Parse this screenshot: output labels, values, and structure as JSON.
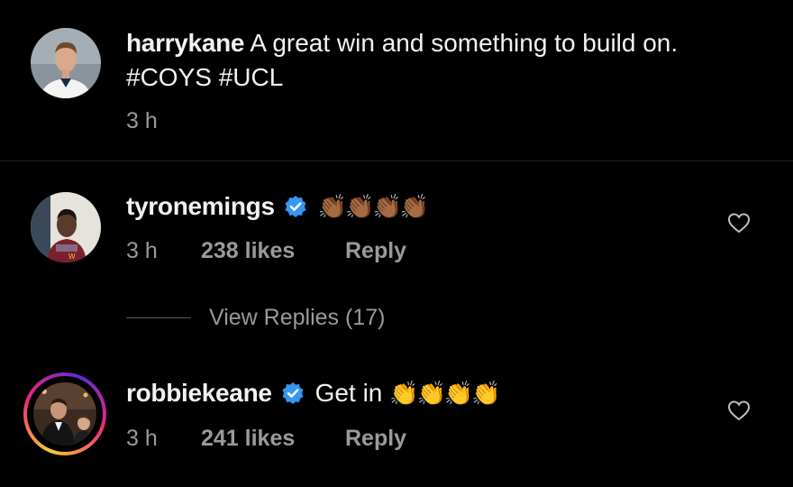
{
  "post": {
    "username": "harrykane",
    "caption_text": " A great win and something to build on. #COYS #UCL",
    "time": "3 h"
  },
  "comments": [
    {
      "username": "tyronemings",
      "verified": true,
      "text": "",
      "emoji": "👏🏾👏🏾👏🏾👏🏾",
      "time": "3 h",
      "likes": "238 likes",
      "reply_label": "Reply"
    },
    {
      "username": "robbiekeane",
      "verified": true,
      "text": "Get in ",
      "emoji": "👏👏👏👏",
      "time": "3 h",
      "likes": "241 likes",
      "reply_label": "Reply"
    }
  ],
  "view_replies": "View Replies (17)",
  "colors": {
    "background": "#000000",
    "text": "#f2f2f2",
    "muted": "#9a9a9a",
    "verified_blue": "#3897f0"
  }
}
